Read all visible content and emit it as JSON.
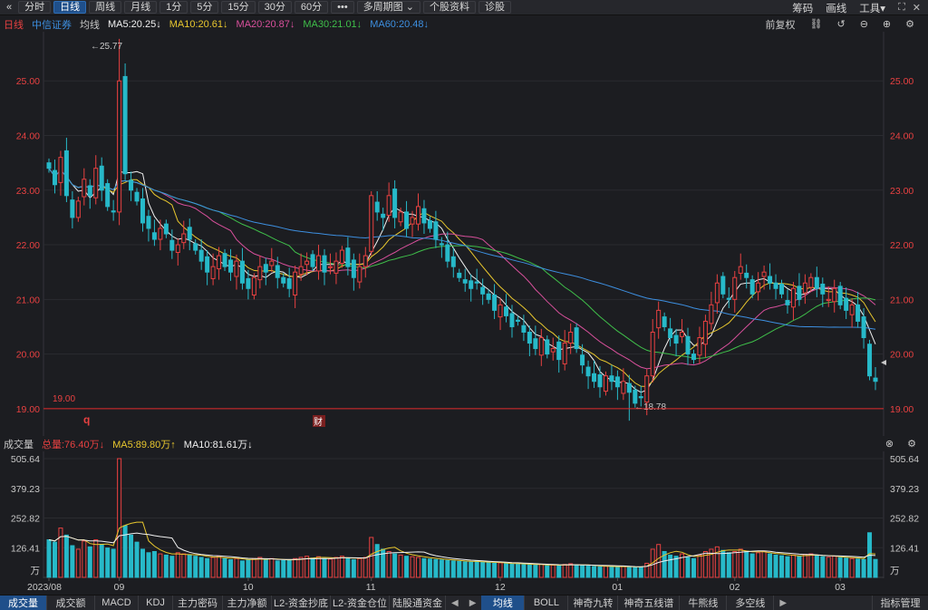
{
  "toolbar": {
    "back_icon": "chevrons-left-icon",
    "buttons": [
      {
        "label": "分时",
        "active": false
      },
      {
        "label": "日线",
        "active": true
      },
      {
        "label": "周线",
        "active": false
      },
      {
        "label": "月线",
        "active": false
      },
      {
        "label": "1分",
        "active": false
      },
      {
        "label": "5分",
        "active": false
      },
      {
        "label": "15分",
        "active": false
      },
      {
        "label": "30分",
        "active": false
      },
      {
        "label": "60分",
        "active": false
      },
      {
        "label": "•••",
        "active": false
      },
      {
        "label": "多周期图 ⌄",
        "active": false
      },
      {
        "label": "个股资料",
        "active": false
      },
      {
        "label": "诊股",
        "active": false
      }
    ],
    "right": {
      "chips_label": "筹码",
      "draw_label": "画线",
      "tools_label": "工具▾",
      "expand_icon": "expand-icon",
      "close_icon": "close-icon"
    }
  },
  "info": {
    "period": "日线",
    "stock_name": "中信证券",
    "ma_label": "均线",
    "ma5": "MA5:20.25↓",
    "ma10": "MA10:20.61↓",
    "ma20": "MA20:20.87↓",
    "ma30": "MA30:21.01↓",
    "ma60": "MA60:20.48↓",
    "adjust": "前复权",
    "colors": {
      "ma5": "#f0f0f0",
      "ma10": "#e8c72e",
      "ma20": "#d9509c",
      "ma30": "#3fbf4a",
      "ma60": "#3d8fe0"
    }
  },
  "price_axis": {
    "labels": [
      "25.00",
      "24.00",
      "23.00",
      "22.00",
      "21.00",
      "20.00",
      "19.00"
    ],
    "values": [
      25,
      24,
      23,
      22,
      21,
      20,
      19
    ],
    "annot_high": "←25.77",
    "annot_low": "←18.78",
    "support_label": "19.00",
    "marker_q": "q",
    "marker_cai": "财"
  },
  "volume": {
    "label": "成交量",
    "total": "总量:76.40万↓",
    "ma5": "MA5:89.80万↑",
    "ma10": "MA10:81.61万↓",
    "axis_labels": [
      "505.64",
      "379.23",
      "252.82",
      "126.41",
      "万"
    ],
    "axis_values": [
      505.64,
      379.23,
      252.82,
      126.41,
      0
    ]
  },
  "x_axis": {
    "labels": [
      "2023/08",
      "09",
      "10",
      "11",
      "12",
      "01",
      "02",
      "03"
    ],
    "indices": [
      0,
      12,
      34,
      55,
      77,
      97,
      117,
      135
    ]
  },
  "bottom_tabs": [
    {
      "label": "成交量",
      "active": true
    },
    {
      "label": "成交额",
      "active": false
    },
    {
      "label": "MACD",
      "active": false
    },
    {
      "label": "KDJ",
      "active": false
    },
    {
      "label": "主力密码",
      "active": false
    },
    {
      "label": "主力净额",
      "active": false
    },
    {
      "label": "L2-资金抄底",
      "active": false
    },
    {
      "label": "L2-资金仓位",
      "active": false
    },
    {
      "label": "陆股通资金",
      "active": false
    }
  ],
  "indicator_tabs": [
    {
      "label": "均线",
      "active": true
    },
    {
      "label": "BOLL",
      "active": false
    },
    {
      "label": "神奇九转",
      "active": false
    },
    {
      "label": "神奇五线谱",
      "active": false
    },
    {
      "label": "牛熊线",
      "active": false
    },
    {
      "label": "多空线",
      "active": false
    }
  ],
  "indicator_manage": "指标管理",
  "chart_data": {
    "type": "candlestick",
    "up_color": "#e84141",
    "down_color": "#27b9c9",
    "closes": [
      23.4,
      23.1,
      23.6,
      22.9,
      22.5,
      22.8,
      23.2,
      22.9,
      23.4,
      23.0,
      22.7,
      22.6,
      25.0,
      23.3,
      23.0,
      22.8,
      22.4,
      22.3,
      22.1,
      22.3,
      22.2,
      21.9,
      22.0,
      22.2,
      22.1,
      21.9,
      21.7,
      21.5,
      21.6,
      21.8,
      21.6,
      21.5,
      21.7,
      21.3,
      21.2,
      21.4,
      21.6,
      21.5,
      21.7,
      21.4,
      21.3,
      21.2,
      21.5,
      21.6,
      21.7,
      21.6,
      21.8,
      21.5,
      21.6,
      21.7,
      21.9,
      21.6,
      21.4,
      21.6,
      21.8,
      22.9,
      22.6,
      22.5,
      22.9,
      22.5,
      22.6,
      22.3,
      22.5,
      22.7,
      22.4,
      22.3,
      22.1,
      22.0,
      21.7,
      21.6,
      21.4,
      21.3,
      21.2,
      21.3,
      21.1,
      21.0,
      20.8,
      20.9,
      20.7,
      20.5,
      20.6,
      20.4,
      20.2,
      20.1,
      20.3,
      20.0,
      20.1,
      19.9,
      20.2,
      20.4,
      20.1,
      19.8,
      19.6,
      19.5,
      19.4,
      19.6,
      19.5,
      19.4,
      19.5,
      19.3,
      19.1,
      19.2,
      19.6,
      20.4,
      20.8,
      20.5,
      20.3,
      20.2,
      20.4,
      20.0,
      19.9,
      20.3,
      20.6,
      20.9,
      21.3,
      21.1,
      21.0,
      21.4,
      21.6,
      21.4,
      21.1,
      21.3,
      21.5,
      21.3,
      21.2,
      21.1,
      20.9,
      21.2,
      21.0,
      21.3,
      21.4,
      21.2,
      21.1,
      21.0,
      21.2,
      20.9,
      20.8,
      20.9,
      20.6,
      20.3,
      19.6,
      19.5
    ],
    "high": 25.77,
    "low": 18.78,
    "support_level": 19.0,
    "volumes": [
      160,
      150,
      210,
      180,
      135,
      120,
      155,
      130,
      160,
      140,
      125,
      120,
      505.64,
      220,
      180,
      150,
      120,
      105,
      110,
      100,
      95,
      90,
      105,
      100,
      95,
      90,
      85,
      80,
      85,
      90,
      80,
      75,
      80,
      70,
      75,
      80,
      85,
      75,
      80,
      70,
      72,
      75,
      80,
      85,
      90,
      82,
      88,
      80,
      78,
      85,
      90,
      82,
      75,
      80,
      85,
      170,
      140,
      120,
      110,
      100,
      95,
      90,
      88,
      85,
      80,
      78,
      76,
      74,
      72,
      70,
      68,
      66,
      65,
      70,
      64,
      62,
      60,
      62,
      58,
      56,
      58,
      55,
      54,
      52,
      56,
      50,
      52,
      50,
      55,
      58,
      54,
      50,
      48,
      46,
      45,
      48,
      46,
      45,
      47,
      44,
      42,
      44,
      60,
      120,
      140,
      110,
      95,
      90,
      100,
      85,
      80,
      95,
      110,
      120,
      130,
      115,
      105,
      110,
      120,
      112,
      100,
      105,
      110,
      100,
      95,
      92,
      88,
      95,
      90,
      98,
      100,
      92,
      88,
      86,
      90,
      84,
      82,
      80,
      78,
      76,
      190,
      76.4
    ],
    "ma_periods": [
      5,
      10,
      20,
      30,
      60
    ],
    "price_range": [
      18.5,
      25.9
    ],
    "volume_max": 505.64
  }
}
